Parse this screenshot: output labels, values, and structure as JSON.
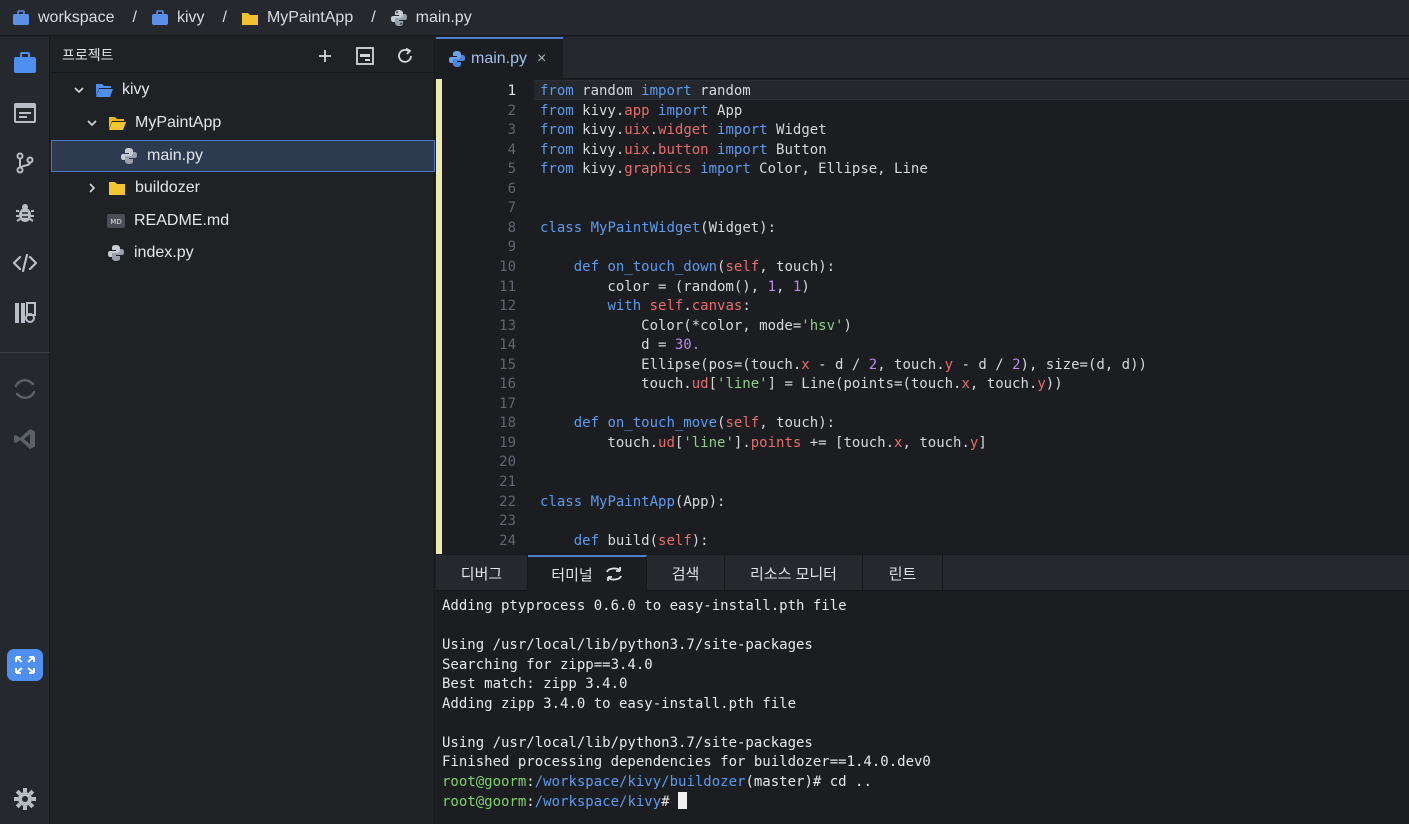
{
  "breadcrumb": {
    "items": [
      {
        "label": "workspace",
        "icon": "briefcase-icon",
        "color": "#5b8fe8"
      },
      {
        "label": "kivy",
        "icon": "briefcase-icon",
        "color": "#5b8fe8"
      },
      {
        "label": "MyPaintApp",
        "icon": "folder-icon",
        "color": "#f1c232"
      },
      {
        "label": "main.py",
        "icon": "python-icon",
        "color": "#c7ccd4"
      }
    ],
    "separator": "/"
  },
  "activity_bar": {
    "icons": [
      "project-icon",
      "window-icon",
      "git-icon",
      "debug-icon",
      "code-icon",
      "notebook-icon",
      "sync-icon",
      "vscode-icon",
      "fullscreen-icon",
      "settings-icon"
    ]
  },
  "sidebar": {
    "title": "프로젝트",
    "tools": [
      "add-icon",
      "collapse-icon",
      "refresh-icon"
    ],
    "tree": [
      {
        "label": "kivy",
        "type": "folder-open-blue",
        "expanded": true
      },
      {
        "label": "MyPaintApp",
        "type": "folder-open",
        "expanded": true
      },
      {
        "label": "main.py",
        "type": "python",
        "selected": true
      },
      {
        "label": "buildozer",
        "type": "folder",
        "expanded": false
      },
      {
        "label": "README.md",
        "type": "markdown"
      },
      {
        "label": "index.py",
        "type": "python"
      }
    ]
  },
  "editor": {
    "tab": {
      "label": "main.py",
      "close": "×"
    },
    "current_line": 1,
    "line_numbers": [
      "1",
      "2",
      "3",
      "4",
      "5",
      "6",
      "7",
      "8",
      "9",
      "10",
      "11",
      "12",
      "13",
      "14",
      "15",
      "16",
      "17",
      "18",
      "19",
      "20",
      "21",
      "22",
      "23",
      "24"
    ],
    "lines": [
      [
        {
          "t": "from",
          "c": "kw"
        },
        {
          "t": " random "
        },
        {
          "t": "import",
          "c": "kw"
        },
        {
          "t": " random"
        }
      ],
      [
        {
          "t": "from",
          "c": "kw"
        },
        {
          "t": " kivy."
        },
        {
          "t": "app",
          "c": "attr"
        },
        {
          "t": " "
        },
        {
          "t": "import",
          "c": "kw"
        },
        {
          "t": " App"
        }
      ],
      [
        {
          "t": "from",
          "c": "kw"
        },
        {
          "t": " kivy."
        },
        {
          "t": "uix",
          "c": "attr"
        },
        {
          "t": "."
        },
        {
          "t": "widget",
          "c": "attr"
        },
        {
          "t": " "
        },
        {
          "t": "import",
          "c": "kw"
        },
        {
          "t": " Widget"
        }
      ],
      [
        {
          "t": "from",
          "c": "kw"
        },
        {
          "t": " kivy."
        },
        {
          "t": "uix",
          "c": "attr"
        },
        {
          "t": "."
        },
        {
          "t": "button",
          "c": "attr"
        },
        {
          "t": " "
        },
        {
          "t": "import",
          "c": "kw"
        },
        {
          "t": " Button"
        }
      ],
      [
        {
          "t": "from",
          "c": "kw"
        },
        {
          "t": " kivy."
        },
        {
          "t": "graphics",
          "c": "attr"
        },
        {
          "t": " "
        },
        {
          "t": "import",
          "c": "kw"
        },
        {
          "t": " Color, Ellipse, Line"
        }
      ],
      [],
      [],
      [
        {
          "t": "class",
          "c": "kw"
        },
        {
          "t": " "
        },
        {
          "t": "MyPaintWidget",
          "c": "kw"
        },
        {
          "t": "(Widget):"
        }
      ],
      [],
      [
        {
          "t": "    "
        },
        {
          "t": "def",
          "c": "kw"
        },
        {
          "t": " "
        },
        {
          "t": "on_touch_down",
          "c": "kw"
        },
        {
          "t": "("
        },
        {
          "t": "self",
          "c": "attr"
        },
        {
          "t": ", touch):"
        }
      ],
      [
        {
          "t": "        color = (random(), "
        },
        {
          "t": "1",
          "c": "num"
        },
        {
          "t": ", "
        },
        {
          "t": "1",
          "c": "num"
        },
        {
          "t": ")"
        }
      ],
      [
        {
          "t": "        "
        },
        {
          "t": "with",
          "c": "kw"
        },
        {
          "t": " "
        },
        {
          "t": "self",
          "c": "attr"
        },
        {
          "t": "."
        },
        {
          "t": "canvas",
          "c": "attr"
        },
        {
          "t": ":"
        }
      ],
      [
        {
          "t": "            Color(*color, mode="
        },
        {
          "t": "'hsv'",
          "c": "str"
        },
        {
          "t": ")"
        }
      ],
      [
        {
          "t": "            d = "
        },
        {
          "t": "30.",
          "c": "num"
        }
      ],
      [
        {
          "t": "            Ellipse(pos=(touch."
        },
        {
          "t": "x",
          "c": "attr"
        },
        {
          "t": " - d / "
        },
        {
          "t": "2",
          "c": "num"
        },
        {
          "t": ", touch."
        },
        {
          "t": "y",
          "c": "attr"
        },
        {
          "t": " - d / "
        },
        {
          "t": "2",
          "c": "num"
        },
        {
          "t": "), size=(d, d))"
        }
      ],
      [
        {
          "t": "            touch."
        },
        {
          "t": "ud",
          "c": "attr"
        },
        {
          "t": "["
        },
        {
          "t": "'line'",
          "c": "str"
        },
        {
          "t": "] = Line(points=(touch."
        },
        {
          "t": "x",
          "c": "attr"
        },
        {
          "t": ", touch."
        },
        {
          "t": "y",
          "c": "attr"
        },
        {
          "t": "))"
        }
      ],
      [],
      [
        {
          "t": "    "
        },
        {
          "t": "def",
          "c": "kw"
        },
        {
          "t": " "
        },
        {
          "t": "on_touch_move",
          "c": "kw"
        },
        {
          "t": "("
        },
        {
          "t": "self",
          "c": "attr"
        },
        {
          "t": ", touch):"
        }
      ],
      [
        {
          "t": "        touch."
        },
        {
          "t": "ud",
          "c": "attr"
        },
        {
          "t": "["
        },
        {
          "t": "'line'",
          "c": "str"
        },
        {
          "t": "]."
        },
        {
          "t": "points",
          "c": "attr"
        },
        {
          "t": " += [touch."
        },
        {
          "t": "x",
          "c": "attr"
        },
        {
          "t": ", touch."
        },
        {
          "t": "y",
          "c": "attr"
        },
        {
          "t": "]"
        }
      ],
      [],
      [],
      [
        {
          "t": "class",
          "c": "kw"
        },
        {
          "t": " "
        },
        {
          "t": "MyPaintApp",
          "c": "kw"
        },
        {
          "t": "(App):"
        }
      ],
      [],
      [
        {
          "t": "    "
        },
        {
          "t": "def",
          "c": "kw"
        },
        {
          "t": " build("
        },
        {
          "t": "self",
          "c": "attr"
        },
        {
          "t": "):"
        }
      ]
    ]
  },
  "bottom_panel": {
    "tabs": [
      {
        "label": "디버그",
        "active": false
      },
      {
        "label": "터미널",
        "active": true,
        "icon": "swap-icon"
      },
      {
        "label": "검색",
        "active": false
      },
      {
        "label": "리소스 모니터",
        "active": false
      },
      {
        "label": "린트",
        "active": false
      }
    ],
    "terminal": {
      "lines": [
        "Adding ptyprocess 0.6.0 to easy-install.pth file",
        "",
        "Using /usr/local/lib/python3.7/site-packages",
        "Searching for zipp==3.4.0",
        "Best match: zipp 3.4.0",
        "Adding zipp 3.4.0 to easy-install.pth file",
        "",
        "Using /usr/local/lib/python3.7/site-packages",
        "Finished processing dependencies for buildozer==1.4.0.dev0"
      ],
      "prompts": [
        {
          "user": "root@goorm",
          "sep": ":",
          "path": "/workspace/kivy/buildozer",
          "branch": "(master)",
          "symbol": "#",
          "command": " cd .."
        },
        {
          "user": "root@goorm",
          "sep": ":",
          "path": "/workspace/kivy",
          "branch": "",
          "symbol": "#",
          "command": " "
        }
      ]
    }
  },
  "colors": {
    "accent": "#4a7fd1",
    "keyword": "#5b9bf0",
    "attribute": "#e96c6c",
    "number": "#b58cf0",
    "string": "#8ed087",
    "prompt_user": "#7fd36b"
  }
}
